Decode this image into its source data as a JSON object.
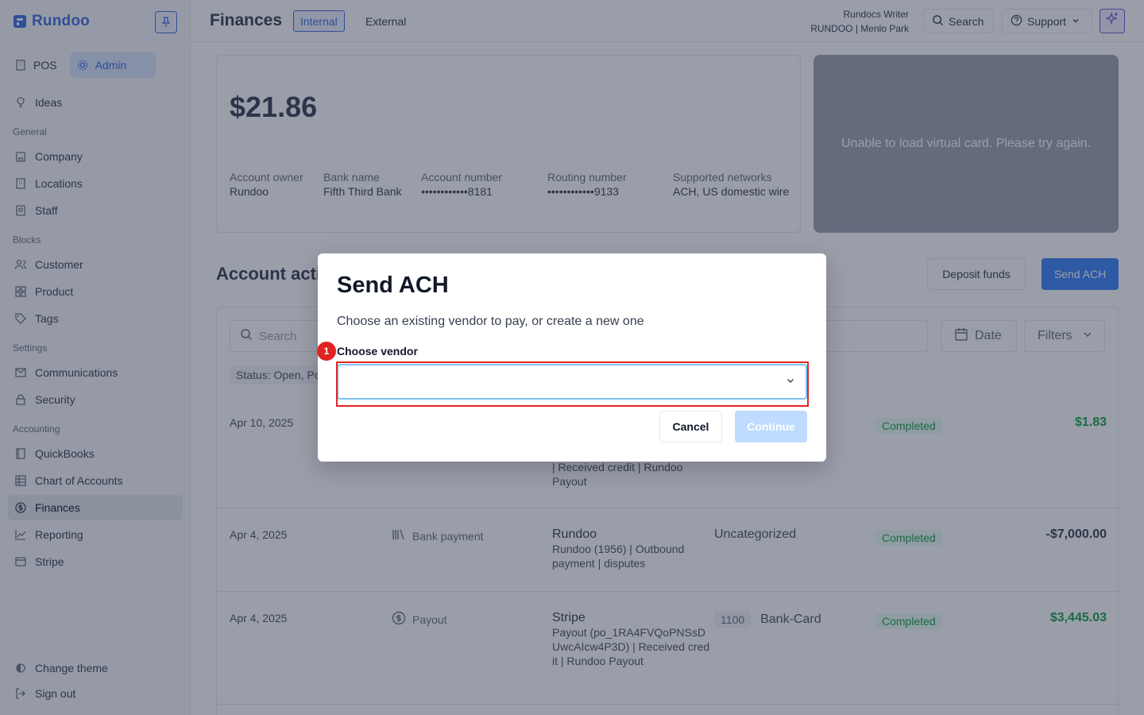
{
  "app": {
    "name": "Rundoo"
  },
  "sidebar": {
    "modes": [
      {
        "label": "POS",
        "icon": "building-icon"
      },
      {
        "label": "Admin",
        "icon": "gear-icon"
      }
    ],
    "ideas": "Ideas",
    "sections": {
      "general": "General",
      "blocks": "Blocks",
      "settings": "Settings",
      "accounting": "Accounting"
    },
    "items": {
      "company": "Company",
      "locations": "Locations",
      "staff": "Staff",
      "customer": "Customer",
      "product": "Product",
      "tags": "Tags",
      "communications": "Communications",
      "security": "Security",
      "quickbooks": "QuickBooks",
      "chart_of_accounts": "Chart of Accounts",
      "finances": "Finances",
      "reporting": "Reporting",
      "stripe": "Stripe"
    },
    "footer": {
      "change_theme": "Change theme",
      "sign_out": "Sign out"
    }
  },
  "header": {
    "title": "Finances",
    "tabs": [
      {
        "label": "Internal",
        "active": true
      },
      {
        "label": "External",
        "active": false
      }
    ],
    "user_name": "Rundocs Writer",
    "user_org": "RUNDOO | Menlo Park",
    "search_label": "Search",
    "support_label": "Support"
  },
  "account": {
    "balance": "$21.86",
    "fields": [
      {
        "key": "Account owner",
        "value": "Rundoo"
      },
      {
        "key": "Bank name",
        "value": "Fifth Third Bank"
      },
      {
        "key": "Account number",
        "value": "••••••••••••8181"
      },
      {
        "key": "Routing number",
        "value": "••••••••••••9133"
      },
      {
        "key": "Supported networks",
        "value": "ACH, US domestic wire"
      }
    ],
    "virtual_card_message": "Unable to load virtual card. Please try again."
  },
  "activity": {
    "title": "Account activity",
    "deposit_label": "Deposit funds",
    "send_ach_label": "Send ACH",
    "search_placeholder": "Search",
    "date_label": "Date",
    "filters_label": "Filters",
    "status_chip": "Status: Open, Posted, Completed",
    "rows": [
      {
        "date": "Apr 10, 2025",
        "type": "",
        "title": "",
        "subtitle": "| Received credit | Rundoo Payout",
        "account_code": "",
        "category": "",
        "status": "Completed",
        "amount": "$1.83"
      },
      {
        "date": "Apr 4, 2025",
        "type": "Bank payment",
        "title": "Rundoo",
        "subtitle": "Rundoo (1956) | Outbound payment | disputes",
        "account_code": "",
        "category": "Uncategorized",
        "status": "Completed",
        "amount": "-$7,000.00"
      },
      {
        "date": "Apr 4, 2025",
        "type": "Payout",
        "title": "Stripe",
        "subtitle": "Payout (po_1RA4FVQoPNSsDUwcAIcw4P3D) | Received credit | Rundoo Payout",
        "account_code": "1100",
        "category": "Bank-Card",
        "status": "Completed",
        "amount": "$3,445.03"
      }
    ]
  },
  "modal": {
    "title": "Send ACH",
    "description": "Choose an existing vendor to pay, or create a new one",
    "field_label": "Choose vendor",
    "field_value": "",
    "marker": "1",
    "cancel_label": "Cancel",
    "continue_label": "Continue"
  },
  "colors": {
    "brand": "#3b6fe0",
    "positive": "#16a34a",
    "highlight": "#e02424",
    "focus_ring": "#7cc4f4"
  }
}
